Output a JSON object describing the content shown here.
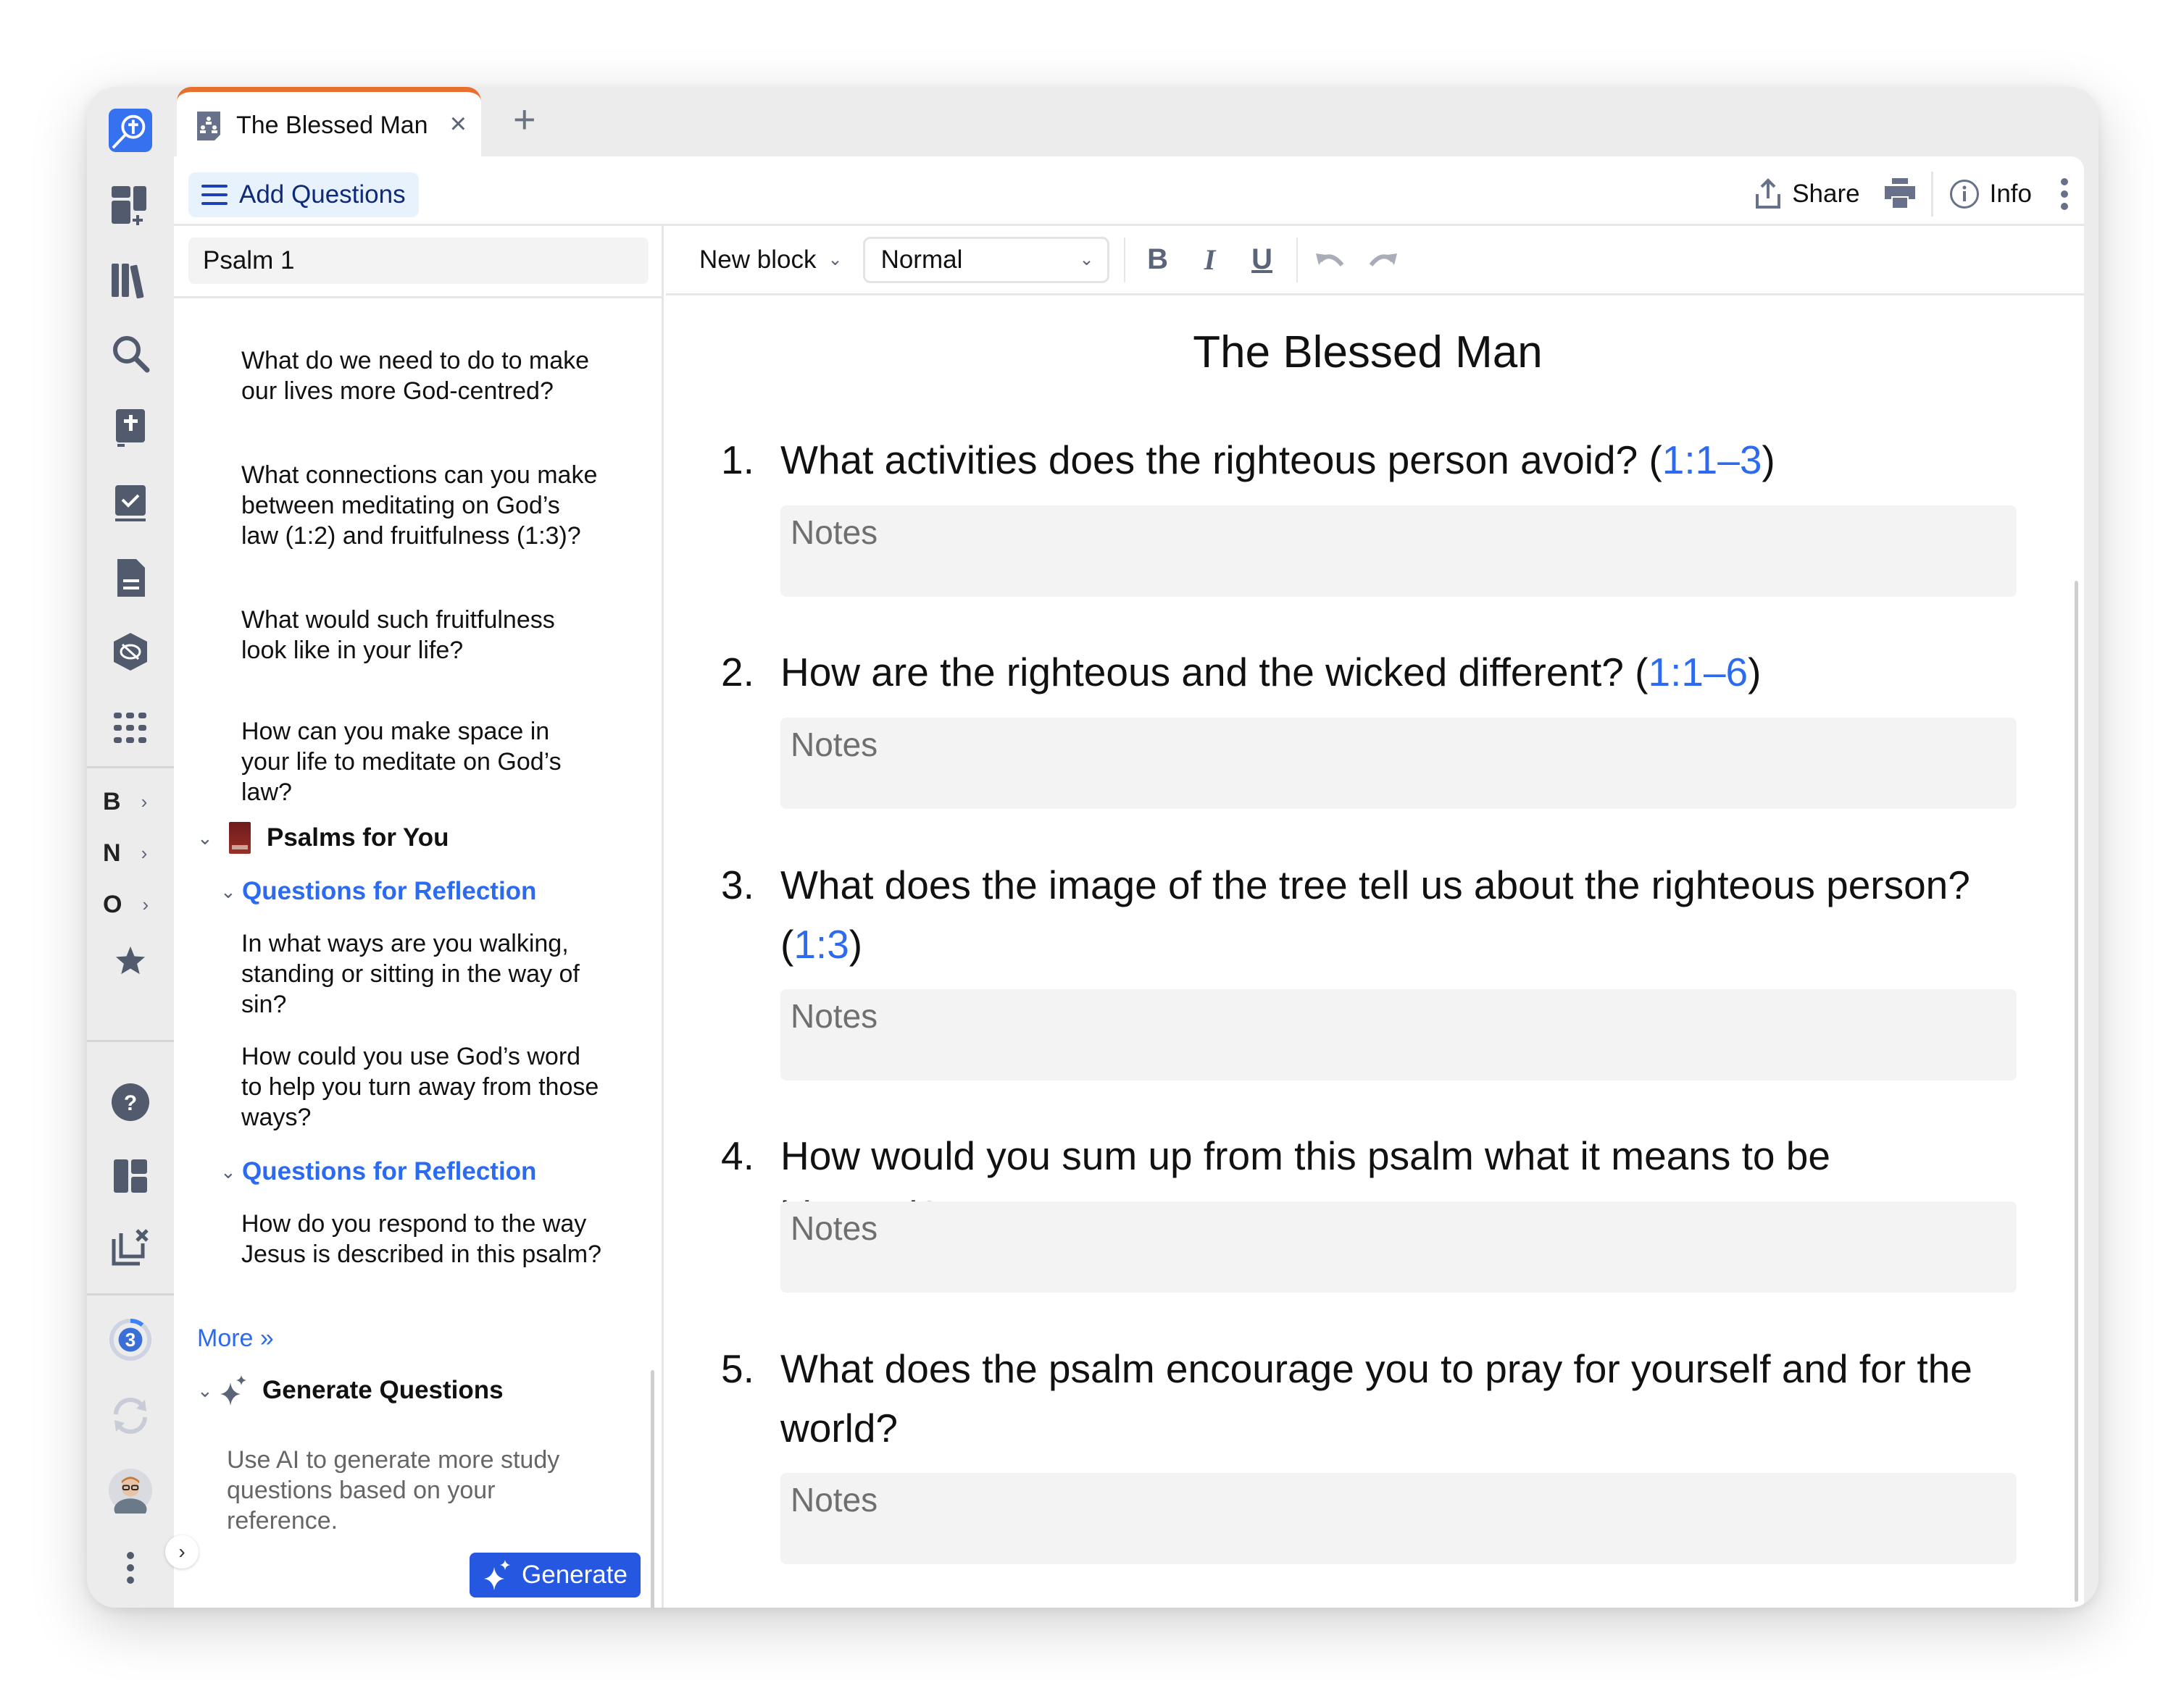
{
  "tabs": [
    {
      "title": "The Blessed Man",
      "icon": "study-guide-icon",
      "active": true
    }
  ],
  "tabbar": {
    "new_tab": "+",
    "close": "×"
  },
  "toolbar": {
    "add_questions_label": "Add Questions",
    "share_label": "Share",
    "info_label": "Info"
  },
  "rail": {
    "letters": [
      "B",
      "N",
      "O"
    ],
    "progress_badge": "3"
  },
  "left_panel": {
    "search_value": "Psalm 1",
    "questions_top": [
      "What do we need to do to make our lives more God-centred?",
      "What connections can you make between meditating on God’s law (1:2) and fruitfulness (1:3)?",
      "What would such fruitfulness look like in your life?",
      "How can you make space in your life to meditate on God’s law?"
    ],
    "resource_title": "Psalms for You",
    "sections": [
      {
        "title": "Questions for Reflection",
        "questions": [
          "In what ways are you walking, standing or sitting in the way of sin?",
          "How could you use God’s word to help you turn away from those ways?"
        ]
      },
      {
        "title": "Questions for Reflection",
        "questions": [
          "How do you respond to the way Jesus is described in this psalm?"
        ]
      }
    ],
    "more_link": "More »",
    "generate": {
      "title": "Generate Questions",
      "description": "Use AI to generate more study questions based on your reference.",
      "button_label": "Generate"
    }
  },
  "format_bar": {
    "new_block_label": "New block",
    "style_value": "Normal",
    "bold": "B",
    "italic": "I",
    "underline": "U"
  },
  "document": {
    "title": "The Blessed Man",
    "notes_placeholder": "Notes",
    "questions": [
      {
        "number": "1.",
        "text": "What activities does the righteous person avoid? ",
        "ref": "1:1–3"
      },
      {
        "number": "2.",
        "text": "How are the righteous and the wicked different? ",
        "ref": "1:1–6"
      },
      {
        "number": "3.",
        "text": "What does the image of the tree tell us about the righteous person? ",
        "ref": "1:3"
      },
      {
        "number": "4.",
        "text": "How would you sum up from this psalm what it means to be blessed?",
        "ref": null
      },
      {
        "number": "5.",
        "text": "What does the psalm encourage you to pray for yourself and for the world?",
        "ref": null
      }
    ]
  },
  "colors": {
    "accent_blue": "#2c6bf0",
    "button_blue": "#2657e0",
    "tab_accent_orange": "#e8702f",
    "icon_gray": "#5b6478"
  }
}
